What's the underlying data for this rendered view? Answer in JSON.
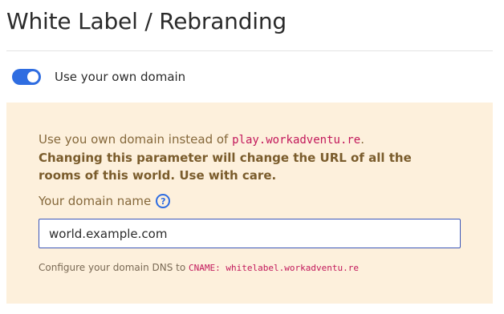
{
  "page": {
    "title": "White Label / Rebranding"
  },
  "toggle": {
    "label": "Use your own domain",
    "checked": true,
    "color": "#2f6de1"
  },
  "panel": {
    "description_prefix": "Use you own domain instead of ",
    "description_code": "play.workadventu.re",
    "description_suffix": ".",
    "warning": "Changing this parameter will change the URL of all the rooms of this world. Use with care.",
    "field_label": "Your domain name",
    "help_icon": "question-circle-icon",
    "input_value": "world.example.com",
    "hint_prefix": "Configure your domain DNS to ",
    "hint_code": "CNAME: whitelabel.workadventu.re",
    "background": "#fdf0dc"
  }
}
